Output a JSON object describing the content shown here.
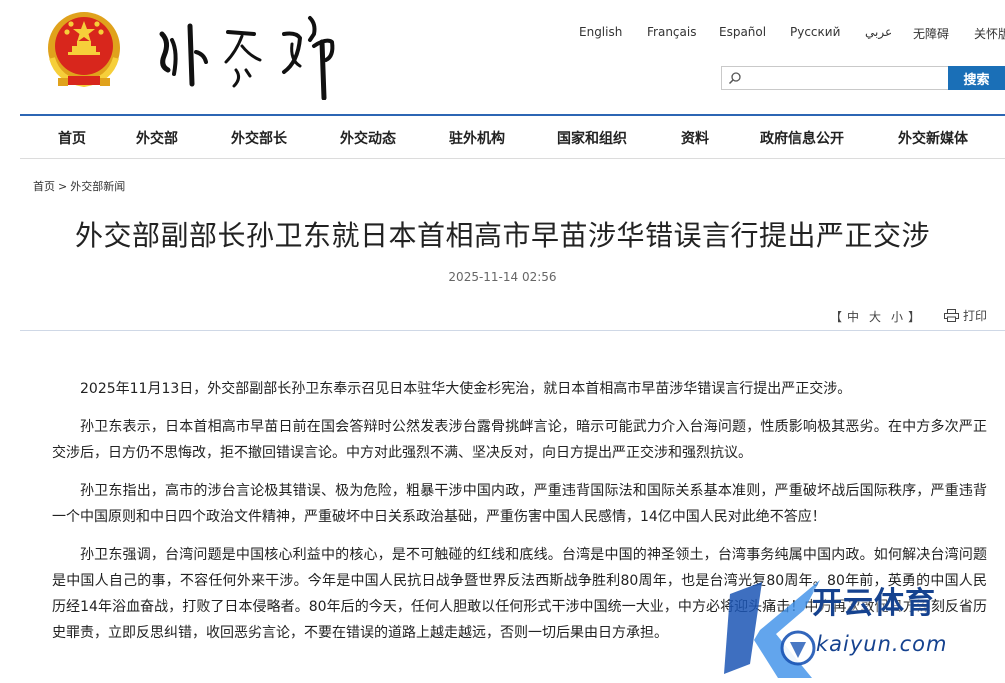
{
  "header": {
    "languages": [
      "English",
      "Français",
      "Español",
      "Русский",
      "عربي",
      "无障碍",
      "关怀版"
    ],
    "search": {
      "placeholder": "",
      "button_label": "搜索"
    },
    "colors": {
      "accent": "#1a6fb7",
      "nav_line": "#2c66b4"
    }
  },
  "nav": {
    "items": [
      "首页",
      "外交部",
      "外交部长",
      "外交动态",
      "驻外机构",
      "国家和组织",
      "资料",
      "政府信息公开",
      "外交新媒体"
    ]
  },
  "breadcrumb": {
    "home": "首页",
    "separator": ">",
    "section": "外交部新闻"
  },
  "article": {
    "title": "外交部副部长孙卫东就日本首相高市早苗涉华错误言行提出严正交涉",
    "date": "2025-11-14 02:56",
    "font_controls": {
      "open": "【",
      "large": "中",
      "medium": "大",
      "small": "小",
      "close": "】"
    },
    "print_label": "打印",
    "paragraphs": [
      "2025年11月13日，外交部副部长孙卫东奉示召见日本驻华大使金杉宪治，就日本首相高市早苗涉华错误言行提出严正交涉。",
      "孙卫东表示，日本首相高市早苗日前在国会答辩时公然发表涉台露骨挑衅言论，暗示可能武力介入台海问题，性质影响极其恶劣。在中方多次严正交涉后，日方仍不思悔改，拒不撤回错误言论。中方对此强烈不满、坚决反对，向日方提出严正交涉和强烈抗议。",
      "孙卫东指出，高市的涉台言论极其错误、极为危险，粗暴干涉中国内政，严重违背国际法和国际关系基本准则，严重破坏战后国际秩序，严重违背一个中国原则和中日四个政治文件精神，严重破坏中日关系政治基础，严重伤害中国人民感情，14亿中国人民对此绝不答应！",
      "孙卫东强调，台湾问题是中国核心利益中的核心，是不可触碰的红线和底线。台湾是中国的神圣领土，台湾事务纯属中国内政。如何解决台湾问题是中国人自己的事，不容任何外来干涉。今年是中国人民抗日战争暨世界反法西斯战争胜利80周年，也是台湾光复80周年。80年前，英勇的中国人民历经14年浴血奋战，打败了日本侵略者。80年后的今天，任何人胆敢以任何形式干涉中国统一大业，中方必将迎头痛击！中方再次敦促日方深刻反省历史罪责，立即反思纠错，收回恶劣言论，不要在错误的道路上越走越远，否则一切后果由日方承担。"
    ]
  },
  "watermark": {
    "cn": "开云体育",
    "en": "kaiyun.com"
  }
}
